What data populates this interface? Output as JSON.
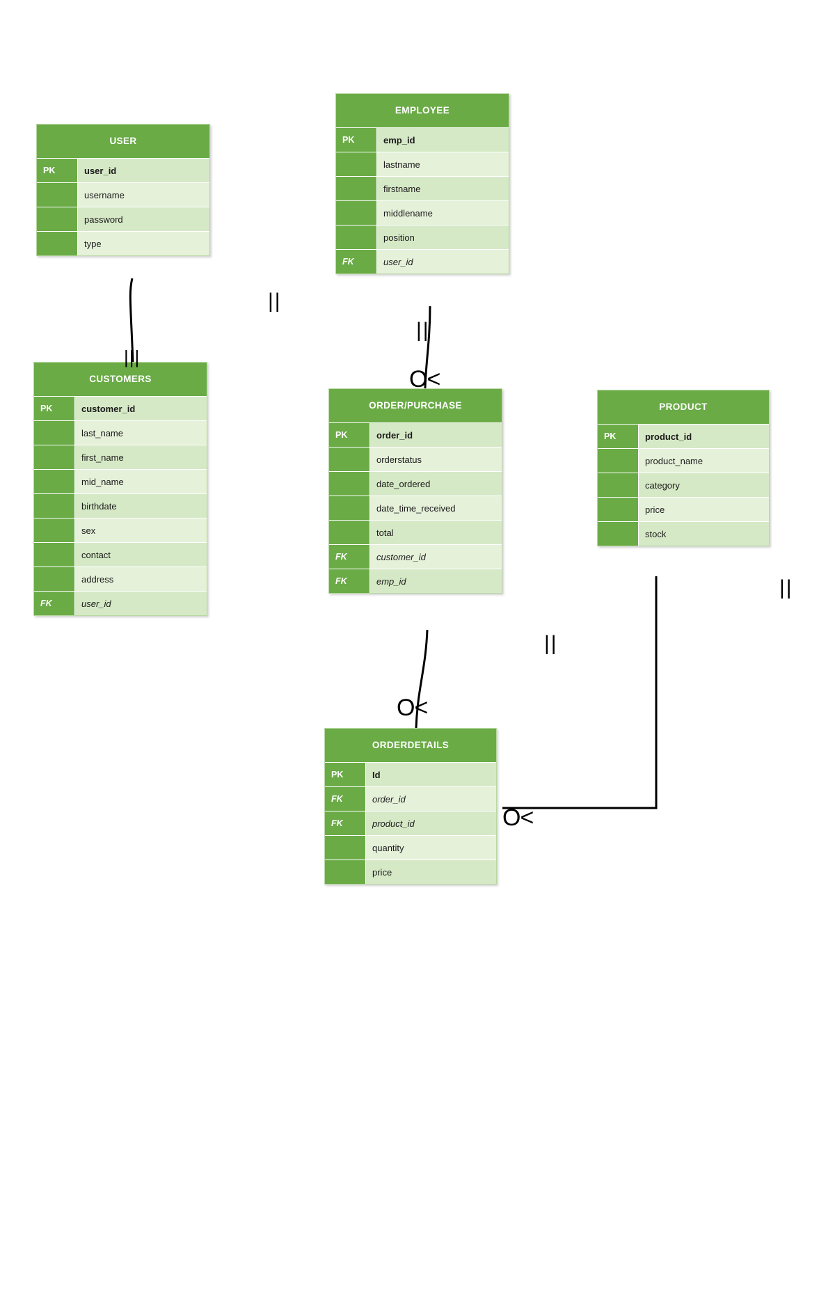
{
  "diagram": {
    "type": "entity-relationship-diagram",
    "notation": "crows-foot",
    "colors": {
      "header": "#6aab46",
      "row_light": "#e6f1da",
      "row_dark": "#d6e9c6",
      "key_column": "#6aab46",
      "title_text": "#ffffff",
      "field_text": "#1a1a1a",
      "connector": "#000000"
    }
  },
  "entities": [
    {
      "id": "user",
      "title": "USER",
      "fields": [
        {
          "key": "PK",
          "name": "user_id"
        },
        {
          "key": "",
          "name": "username"
        },
        {
          "key": "",
          "name": "password"
        },
        {
          "key": "",
          "name": "type"
        }
      ]
    },
    {
      "id": "employee",
      "title": "EMPLOYEE",
      "fields": [
        {
          "key": "PK",
          "name": "emp_id"
        },
        {
          "key": "",
          "name": "lastname"
        },
        {
          "key": "",
          "name": "firstname"
        },
        {
          "key": "",
          "name": "middlename"
        },
        {
          "key": "",
          "name": "position"
        },
        {
          "key": "FK",
          "name": "user_id"
        }
      ]
    },
    {
      "id": "customers",
      "title": "CUSTOMERS",
      "fields": [
        {
          "key": "PK",
          "name": "customer_id"
        },
        {
          "key": "",
          "name": "last_name"
        },
        {
          "key": "",
          "name": "first_name"
        },
        {
          "key": "",
          "name": "mid_name"
        },
        {
          "key": "",
          "name": "birthdate"
        },
        {
          "key": "",
          "name": "sex"
        },
        {
          "key": "",
          "name": "contact"
        },
        {
          "key": "",
          "name": "address"
        },
        {
          "key": "FK",
          "name": "user_id"
        }
      ]
    },
    {
      "id": "order_purchase",
      "title": "ORDER/PURCHASE",
      "fields": [
        {
          "key": "PK",
          "name": "order_id"
        },
        {
          "key": "",
          "name": "orderstatus"
        },
        {
          "key": "",
          "name": "date_ordered"
        },
        {
          "key": "",
          "name": "date_time_received"
        },
        {
          "key": "",
          "name": "total"
        },
        {
          "key": "FK",
          "name": "customer_id"
        },
        {
          "key": "FK",
          "name": "emp_id"
        }
      ]
    },
    {
      "id": "product",
      "title": "PRODUCT",
      "fields": [
        {
          "key": "PK",
          "name": "product_id"
        },
        {
          "key": "",
          "name": "product_name"
        },
        {
          "key": "",
          "name": "category"
        },
        {
          "key": "",
          "name": "price"
        },
        {
          "key": "",
          "name": "stock"
        }
      ]
    },
    {
      "id": "orderdetails",
      "title": "ORDERDETAILS",
      "fields": [
        {
          "key": "PK",
          "name": "Id"
        },
        {
          "key": "FK",
          "name": "order_id"
        },
        {
          "key": "FK",
          "name": "product_id"
        },
        {
          "key": "",
          "name": "quantity"
        },
        {
          "key": "",
          "name": "price"
        }
      ]
    }
  ],
  "cardinality_markers": [
    {
      "id": "m1",
      "glyph": "|||",
      "meaning": "one-mandatory-user-to-customers"
    },
    {
      "id": "m2",
      "glyph": "||",
      "meaning": "one-mandatory-left-of-employee"
    },
    {
      "id": "m3",
      "glyph": "||",
      "meaning": "one-mandatory-employee-to-order"
    },
    {
      "id": "m4",
      "glyph": "O<",
      "meaning": "zero-or-many-order-from-employee"
    },
    {
      "id": "m5",
      "glyph": "O<",
      "meaning": "zero-or-many-orderdetails-from-order"
    },
    {
      "id": "m6",
      "glyph": "||",
      "meaning": "one-mandatory-product-side"
    },
    {
      "id": "m7",
      "glyph": "||",
      "meaning": "one-mandatory-product-to-orderdetails"
    },
    {
      "id": "m8",
      "glyph": "O<",
      "meaning": "zero-or-many-orderdetails-from-product"
    }
  ]
}
